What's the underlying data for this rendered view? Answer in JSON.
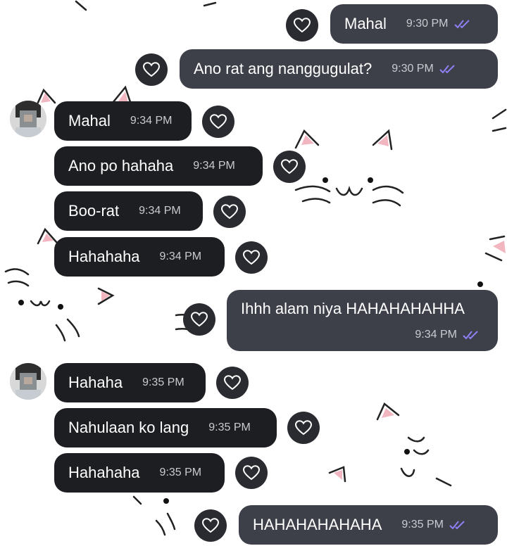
{
  "accent_colors": {
    "check": "#8f80f5",
    "bubble_in": "#1d1e22",
    "bubble_out": "#3d4049"
  },
  "icons": {
    "reaction": "heart-outline-icon",
    "read_receipt": "double-check-icon"
  },
  "messages": [
    {
      "side": "out",
      "text": "Mahal",
      "time": "9:30 PM",
      "read": true
    },
    {
      "side": "out",
      "text": "Ano rat ang nanggugulat?",
      "time": "9:30 PM",
      "read": true
    },
    {
      "side": "in",
      "text": "Mahal",
      "time": "9:34 PM"
    },
    {
      "side": "in",
      "text": "Ano po hahaha",
      "time": "9:34 PM"
    },
    {
      "side": "in",
      "text": "Boo-rat",
      "time": "9:34 PM"
    },
    {
      "side": "in",
      "text": "Hahahaha",
      "time": "9:34 PM"
    },
    {
      "side": "out",
      "text": "Ihhh alam niya HAHAHAHAHHA",
      "time": "9:34 PM",
      "read": true
    },
    {
      "side": "in",
      "text": "Hahaha",
      "time": "9:35 PM"
    },
    {
      "side": "in",
      "text": "Nahulaan ko lang",
      "time": "9:35 PM"
    },
    {
      "side": "in",
      "text": "Hahahaha",
      "time": "9:35 PM"
    },
    {
      "side": "out",
      "text": "HAHAHAHAHAHA",
      "time": "9:35 PM",
      "read": true
    }
  ]
}
